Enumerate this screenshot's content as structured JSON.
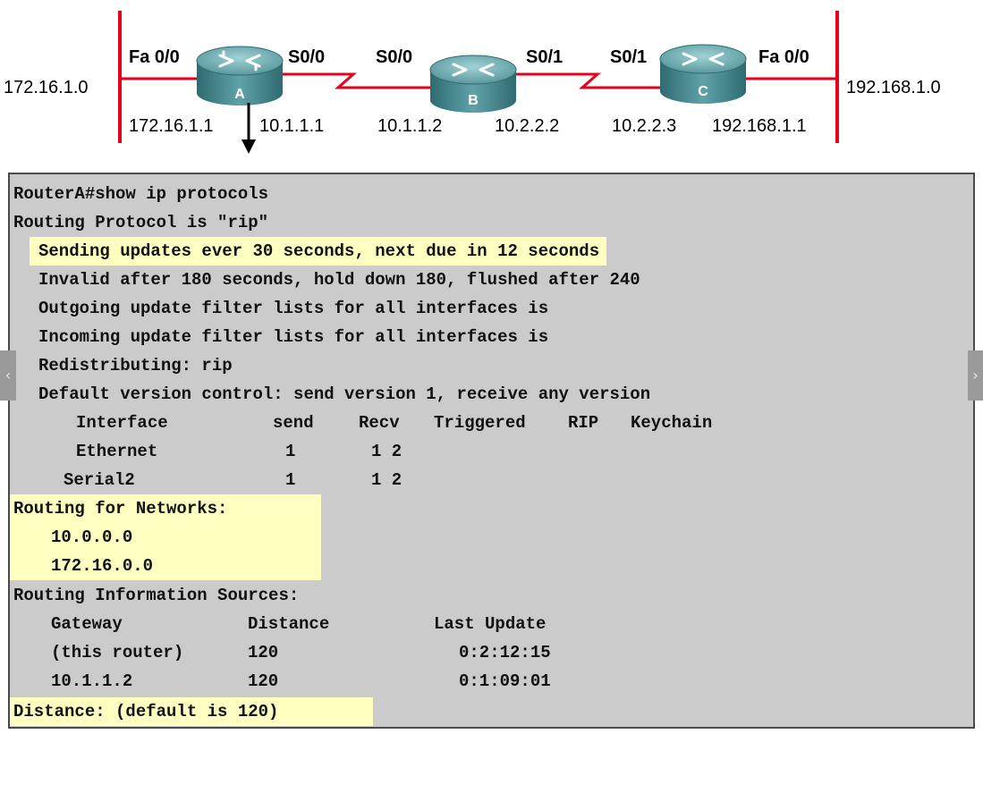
{
  "diagram": {
    "networks": {
      "left": "172.16.1.0",
      "right": "192.168.1.0"
    },
    "routers": {
      "a": {
        "label": "A",
        "fa_if": "Fa 0/0",
        "fa_ip": "172.16.1.1",
        "s_if": "S0/0",
        "s_ip": "10.1.1.1"
      },
      "b": {
        "label": "B",
        "s00_if": "S0/0",
        "s00_ip": "10.1.1.2",
        "s01_if": "S0/1",
        "s01_ip": "10.2.2.2"
      },
      "c": {
        "label": "C",
        "s_if": "S0/1",
        "s_ip": "10.2.2.3",
        "fa_if": "Fa 0/0",
        "fa_ip": "192.168.1.1"
      }
    },
    "colors": {
      "ethernet_segment": "#e8001c",
      "serial_link": "#e8001c",
      "router_body": "#4f8f95",
      "highlight": "#ffffc2"
    }
  },
  "terminal": {
    "prompt_line": "RouterA#show ip protocols",
    "protocol_line": "Routing Protocol is \"rip\"",
    "sending_line": "Sending updates ever 30 seconds, next due in 12 seconds",
    "timers_line": "Invalid after 180 seconds, hold down 180, flushed after 240",
    "outgoing_line": "Outgoing update filter lists for all interfaces is",
    "incoming_line": "Incoming update filter lists for all interfaces is",
    "redistributing_line": "Redistributing: rip",
    "version_line": "Default version control: send version 1, receive any version",
    "interface_table": {
      "headers": [
        "Interface",
        "send",
        "Recv",
        "Triggered",
        "RIP",
        "Keychain"
      ],
      "rows": [
        {
          "interface": "Ethernet",
          "send": "1",
          "recv": "1 2"
        },
        {
          "interface": "Serial2",
          "send": "1",
          "recv": "1 2"
        }
      ]
    },
    "networks_heading": "Routing for Networks:",
    "networks": [
      "10.0.0.0",
      "172.16.0.0"
    ],
    "sources_heading": "Routing Information Sources:",
    "sources_table": {
      "headers": [
        "Gateway",
        "Distance",
        "Last Update"
      ],
      "rows": [
        {
          "gateway": "(this router)",
          "distance": "120",
          "last_update": "0:2:12:15"
        },
        {
          "gateway": "10.1.1.2",
          "distance": "120",
          "last_update": "0:1:09:01"
        }
      ]
    },
    "distance_line": "Distance: (default is 120)"
  }
}
